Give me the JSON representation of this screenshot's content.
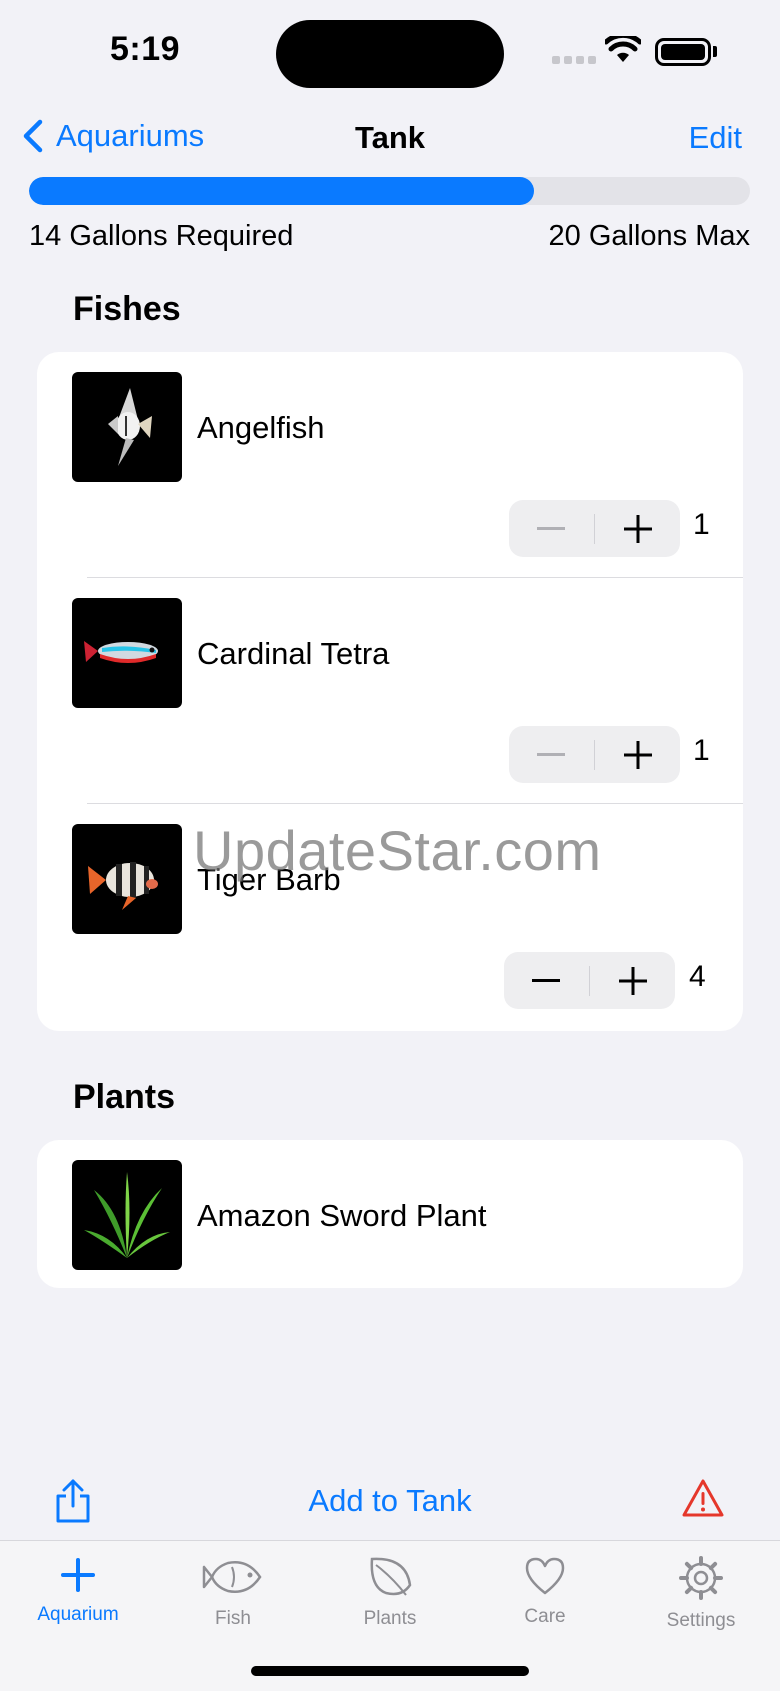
{
  "status_bar": {
    "time": "5:19"
  },
  "nav": {
    "back_label": "Aquariums",
    "title": "Tank",
    "edit_label": "Edit"
  },
  "capacity": {
    "required_label": "14 Gallons Required",
    "max_label": "20 Gallons Max",
    "fill_fraction": 0.7,
    "accent_color": "#0A7AFF"
  },
  "fishes": {
    "header": "Fishes",
    "items": [
      {
        "name": "Angelfish",
        "count": "1",
        "icon": "angelfish-image"
      },
      {
        "name": "Cardinal Tetra",
        "count": "1",
        "icon": "cardinal-tetra-image"
      },
      {
        "name": "Tiger Barb",
        "count": "4",
        "icon": "tiger-barb-image"
      }
    ]
  },
  "plants": {
    "header": "Plants",
    "items": [
      {
        "name": "Amazon Sword Plant",
        "icon": "amazon-sword-plant-image"
      }
    ]
  },
  "watermark": "UpdateStar.com",
  "toolbar": {
    "add_label": "Add to Tank",
    "warning_color": "#E5372B"
  },
  "tabs": [
    {
      "label": "Aquarium",
      "icon": "plus-icon",
      "active": true
    },
    {
      "label": "Fish",
      "icon": "fish-icon",
      "active": false
    },
    {
      "label": "Plants",
      "icon": "leaf-icon",
      "active": false
    },
    {
      "label": "Care",
      "icon": "heart-icon",
      "active": false
    },
    {
      "label": "Settings",
      "icon": "gear-icon",
      "active": false
    }
  ]
}
